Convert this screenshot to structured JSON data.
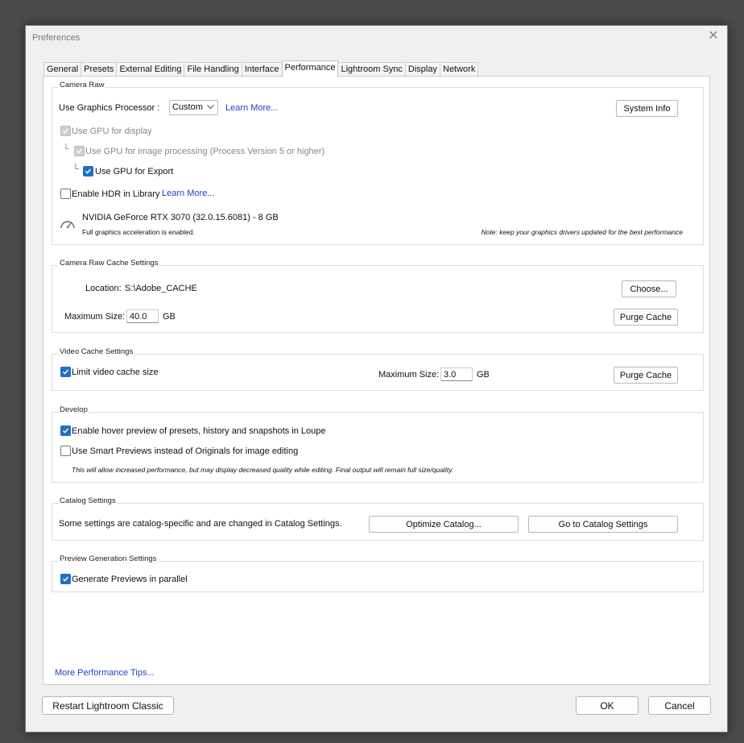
{
  "window": {
    "title": "Preferences"
  },
  "tabs": [
    {
      "label": "General"
    },
    {
      "label": "Presets"
    },
    {
      "label": "External Editing"
    },
    {
      "label": "File Handling"
    },
    {
      "label": "Interface"
    },
    {
      "label": "Performance"
    },
    {
      "label": "Lightroom Sync"
    },
    {
      "label": "Display"
    },
    {
      "label": "Network"
    }
  ],
  "camera_raw": {
    "title": "Camera Raw",
    "gpu_label": "Use Graphics Processor :",
    "gpu_value": "Custom",
    "learn_more": "Learn More...",
    "system_info": "System Info",
    "gpu_display": "Use GPU for display",
    "gpu_processing": "Use GPU for image processing (Process Version 5 or higher)",
    "gpu_export": "Use GPU for Export",
    "hdr_library": "Enable HDR in Library",
    "hdr_learn_more": "Learn More...",
    "gpu_name": "NVIDIA GeForce RTX 3070 (32.0.15.6081) - 8 GB",
    "accel_status": "Full graphics acceleration is enabled.",
    "note": "Note: keep your graphics drivers updated for the best performance",
    "tree_glyph": "└"
  },
  "cache": {
    "title": "Camera Raw Cache Settings",
    "location_label": "Location:",
    "location_value": "S:\\Adobe_CACHE",
    "choose": "Choose...",
    "max_label": "Maximum Size:",
    "max_value": "40.0",
    "unit": "GB",
    "purge": "Purge Cache"
  },
  "video_cache": {
    "title": "Video Cache Settings",
    "limit": "Limit video cache size",
    "max_label": "Maximum Size:",
    "max_value": "3.0",
    "unit": "GB",
    "purge": "Purge Cache"
  },
  "develop": {
    "title": "Develop",
    "hover_preview": "Enable hover preview of presets, history and snapshots in Loupe",
    "smart_previews": "Use Smart Previews instead of Originals for image editing",
    "note": "This will allow increased performance, but may display decreased quality while editing. Final output will remain full size/quality."
  },
  "catalog": {
    "title": "Catalog Settings",
    "desc": "Some settings are catalog-specific and are changed in Catalog Settings.",
    "optimize": "Optimize Catalog...",
    "goto": "Go to Catalog Settings"
  },
  "preview": {
    "title": "Preview Generation Settings",
    "parallel": "Generate Previews in parallel"
  },
  "more_tips": "More Performance Tips...",
  "footer": {
    "restart": "Restart Lightroom Classic",
    "ok": "OK",
    "cancel": "Cancel"
  },
  "colors": {
    "accent": "#1f6fc5",
    "link": "#2040c8",
    "desktop": "#4a4a4a"
  },
  "icons": {
    "close": "close-icon",
    "gauge": "gauge-icon",
    "chevron": "chevron-down-icon"
  }
}
